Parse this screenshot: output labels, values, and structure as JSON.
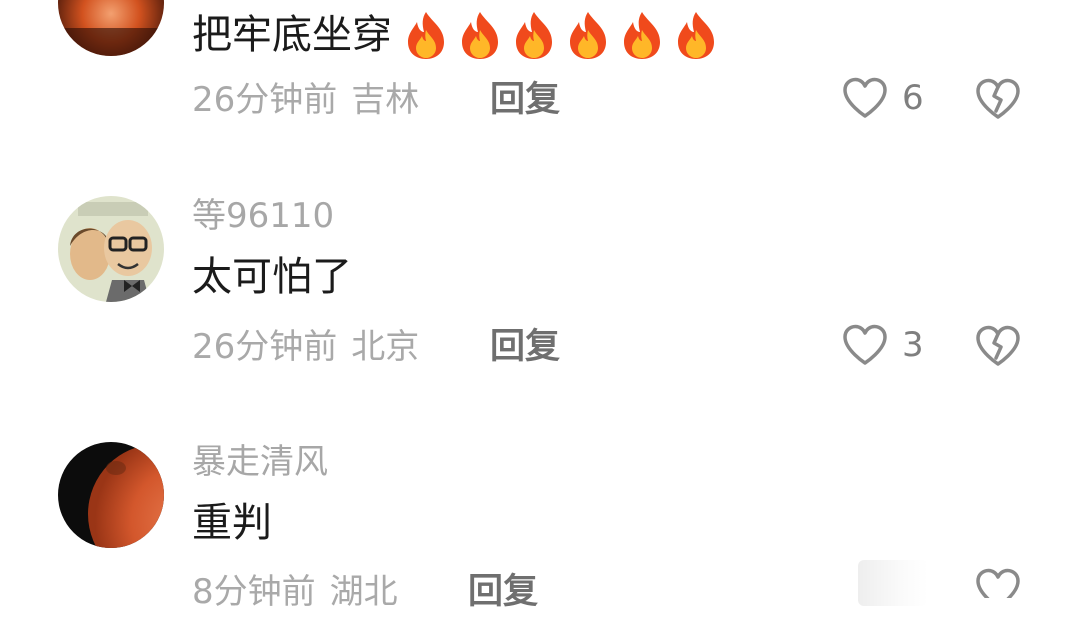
{
  "comments": [
    {
      "username": "",
      "text": "把牢底坐穿",
      "emoji": [
        "fire",
        "fire",
        "fire",
        "fire",
        "fire",
        "fire"
      ],
      "time": "26分钟前",
      "location": "吉林",
      "reply_label": "回复",
      "likes": "6"
    },
    {
      "username": "等96110",
      "text": "太可怕了",
      "time": "26分钟前",
      "location": "北京",
      "reply_label": "回复",
      "likes": "3"
    },
    {
      "username": "暴走清风",
      "text": "重判",
      "time": "8分钟前",
      "location": "湖北",
      "reply_label": "回复",
      "likes": ""
    }
  ],
  "icons": {
    "like": "heart-outline-icon",
    "dislike": "broken-heart-icon",
    "emoji": "fire-emoji"
  },
  "colors": {
    "text": "#1b1b1b",
    "meta": "#a9a9a9",
    "reply": "#6f6f6f",
    "icon": "#8a8a8a"
  }
}
